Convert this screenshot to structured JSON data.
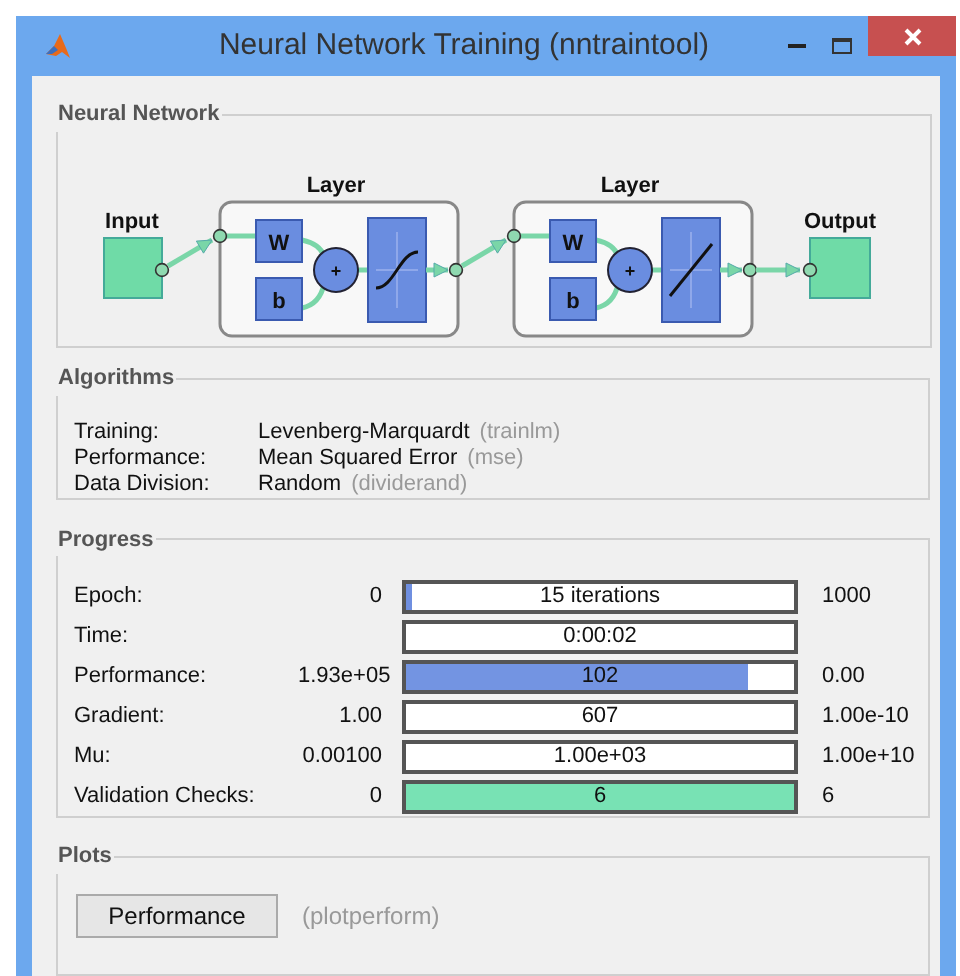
{
  "window": {
    "title": "Neural Network Training (nntraintool)"
  },
  "neural_network": {
    "title": "Neural Network",
    "input_label": "Input",
    "output_label": "Output",
    "layers": [
      {
        "title": "Layer",
        "weight": "W",
        "bias": "b",
        "sum": "+",
        "kind": "sigmoid"
      },
      {
        "title": "Layer",
        "weight": "W",
        "bias": "b",
        "sum": "+",
        "kind": "linear"
      }
    ]
  },
  "algorithms": {
    "title": "Algorithms",
    "rows": [
      {
        "label": "Training:",
        "value": "Levenberg-Marquardt",
        "function": "(trainlm)"
      },
      {
        "label": "Performance:",
        "value": "Mean Squared Error",
        "function": "(mse)"
      },
      {
        "label": "Data Division:",
        "value": "Random",
        "function": "(dividerand)"
      }
    ]
  },
  "progress": {
    "title": "Progress",
    "rows": [
      {
        "label": "Epoch:",
        "start": "0",
        "bar_text": "15 iterations",
        "end": "1000",
        "level": 0.015,
        "color": "#6f8fe0"
      },
      {
        "label": "Time:",
        "bar_text": "0:00:02"
      },
      {
        "label": "Performance:",
        "start": "1.93e+05",
        "bar_text": "102",
        "end": "0.00",
        "level": 0.88,
        "color": "#7394e2"
      },
      {
        "label": "Gradient:",
        "start": "1.00",
        "bar_text": "607",
        "end": "1.00e-10"
      },
      {
        "label": "Mu:",
        "start": "0.00100",
        "bar_text": "1.00e+03",
        "end": "1.00e+10"
      },
      {
        "label": "Validation Checks:",
        "start": "0",
        "bar_text": "6",
        "end": "6",
        "level": 1,
        "color": "#78e2b4"
      }
    ]
  },
  "plots": {
    "title": "Plots",
    "buttons": [
      {
        "label": "Performance",
        "function": "(plotperform)"
      }
    ]
  }
}
